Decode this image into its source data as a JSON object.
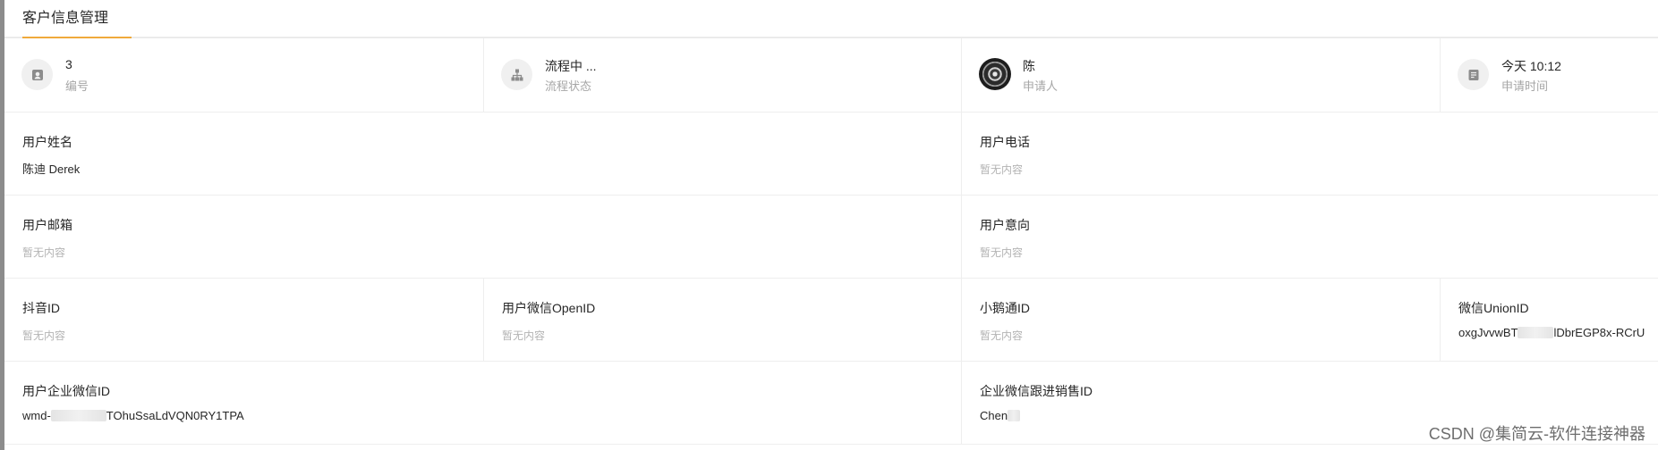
{
  "tab": {
    "label": "客户信息管理",
    "accent": "#f0a93b"
  },
  "summary": [
    {
      "value": "3",
      "label": "编号",
      "icon": "id-card-icon"
    },
    {
      "value": "流程中 ...",
      "label": "流程状态",
      "icon": "flow-tree-icon"
    },
    {
      "value": "陈",
      "label": "申请人",
      "icon": "avatar"
    },
    {
      "value": "今天 10:12",
      "label": "申请时间",
      "icon": "note-icon"
    }
  ],
  "empty_text": "暂无内容",
  "fields": {
    "user_name": {
      "label": "用户姓名",
      "value": "陈迪 Derek"
    },
    "user_phone": {
      "label": "用户电话",
      "value": "暂无内容"
    },
    "user_email": {
      "label": "用户邮箱",
      "value": "暂无内容"
    },
    "user_intent": {
      "label": "用户意向",
      "value": "暂无内容"
    },
    "douyin_id": {
      "label": "抖音ID",
      "value": "暂无内容"
    },
    "wechat_openid": {
      "label": "用户微信OpenID",
      "value": "暂无内容"
    },
    "xiaoetong_id": {
      "label": "小鹅通ID",
      "value": "暂无内容"
    },
    "wechat_unionid": {
      "label": "微信UnionID",
      "value_prefix": "oxgJvvwBT",
      "value_suffix": "lDbrEGP8x-RCrU"
    },
    "wecom_id": {
      "label": "用户企业微信ID",
      "value_prefix": "wmd-",
      "value_suffix": "TOhuSsaLdVQN0RY1TPA"
    },
    "wecom_sales_id": {
      "label": "企业微信跟进销售ID",
      "value_prefix": "Chen",
      "value_suffix": ""
    }
  },
  "watermark": "CSDN @集简云-软件连接神器"
}
